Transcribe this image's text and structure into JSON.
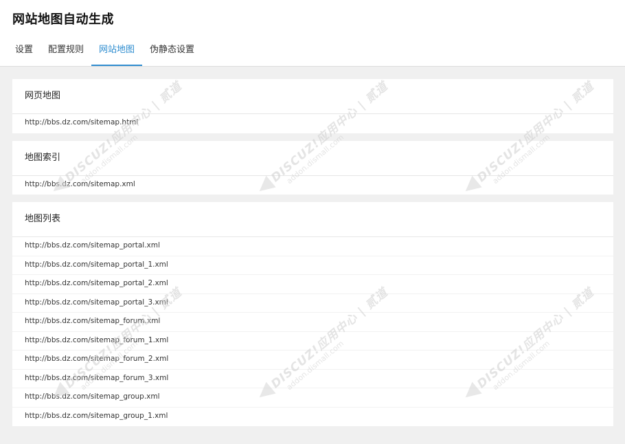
{
  "header": {
    "title": "网站地图自动生成"
  },
  "tabs": [
    {
      "label": "设置",
      "active": false
    },
    {
      "label": "配置规则",
      "active": false
    },
    {
      "label": "网站地图",
      "active": true
    },
    {
      "label": "伪静态设置",
      "active": false
    }
  ],
  "sections": {
    "web_map": {
      "title": "网页地图",
      "items": [
        "http://bbs.dz.com/sitemap.html"
      ]
    },
    "map_index": {
      "title": "地图索引",
      "items": [
        "http://bbs.dz.com/sitemap.xml"
      ]
    },
    "map_list": {
      "title": "地图列表",
      "items": [
        "http://bbs.dz.com/sitemap_portal.xml",
        "http://bbs.dz.com/sitemap_portal_1.xml",
        "http://bbs.dz.com/sitemap_portal_2.xml",
        "http://bbs.dz.com/sitemap_portal_3.xml",
        "http://bbs.dz.com/sitemap_forum.xml",
        "http://bbs.dz.com/sitemap_forum_1.xml",
        "http://bbs.dz.com/sitemap_forum_2.xml",
        "http://bbs.dz.com/sitemap_forum_3.xml",
        "http://bbs.dz.com/sitemap_group.xml",
        "http://bbs.dz.com/sitemap_group_1.xml"
      ]
    }
  },
  "watermark": {
    "line1": "DISCUZ!应用中心 | 贰道",
    "line2": "addon.dismall.com"
  },
  "colors": {
    "accent": "#2d8ccf",
    "background": "#f0f0f0"
  }
}
